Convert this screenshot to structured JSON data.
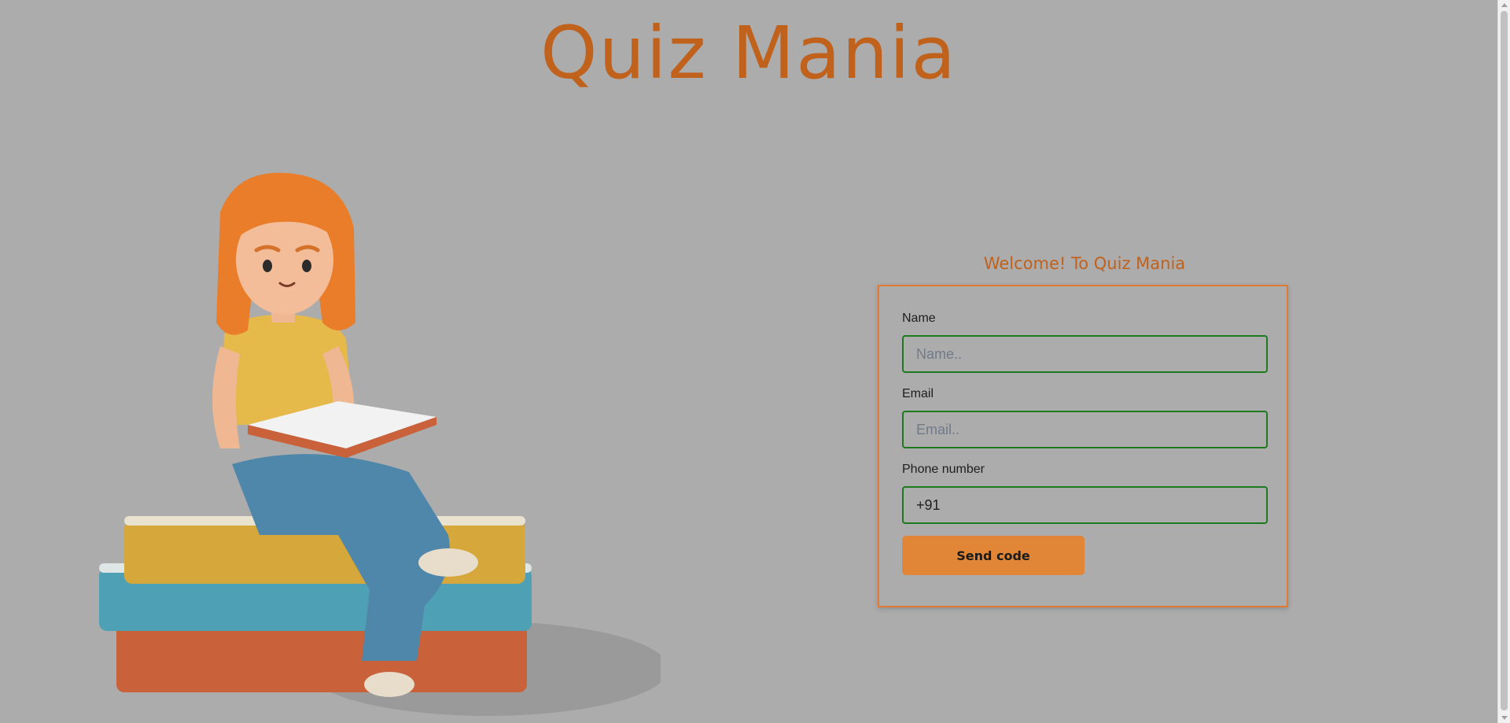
{
  "header": {
    "title": "Quiz Mania"
  },
  "form": {
    "welcome_text": "Welcome! To Quiz Mania",
    "name_label": "Name",
    "name_placeholder": "Name..",
    "name_value": "",
    "email_label": "Email",
    "email_placeholder": "Email..",
    "email_value": "",
    "phone_label": "Phone number",
    "phone_value": "+91",
    "submit_label": "Send code"
  },
  "colors": {
    "background": "#acacac",
    "title": "#c0611c",
    "card_border": "#e07a34",
    "input_border": "#1f7a1f",
    "button": "#e08636"
  },
  "illustration": {
    "icon": "girl-reading-on-books-illustration"
  }
}
